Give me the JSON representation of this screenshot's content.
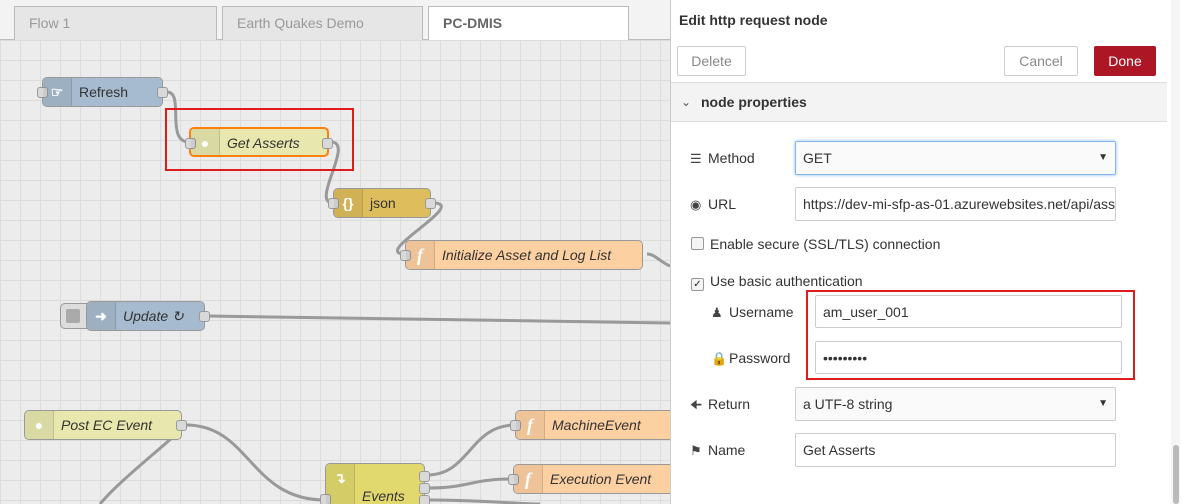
{
  "tabs": [
    {
      "label": "Flow 1"
    },
    {
      "label": "Earth Quakes Demo"
    },
    {
      "label": "PC-DMIS"
    }
  ],
  "nodes": {
    "refresh": {
      "label": "Refresh",
      "icon": "inject-hand-icon",
      "color": "#a6bbcf"
    },
    "get_asserts": {
      "label": "Get Asserts",
      "icon": "globe-icon",
      "color": "#e7e7ae"
    },
    "json": {
      "label": "json",
      "icon": "braces-icon",
      "icon_glyph": "{}",
      "color": "#debd5c"
    },
    "init": {
      "label": "Initialize Asset and Log List",
      "icon": "function-icon",
      "icon_glyph": "f",
      "color": "#fdd0a2"
    },
    "update": {
      "label": "Update ↻",
      "icon": "arrow-right-icon",
      "color": "#a6bbcf"
    },
    "post_ec": {
      "label": "Post EC Event",
      "icon": "globe-icon",
      "color": "#e7e7ae"
    },
    "machine_event": {
      "label": "MachineEvent",
      "icon": "function-icon",
      "icon_glyph": "f",
      "color": "#fdd0a2"
    },
    "execution_event": {
      "label": "Execution Event",
      "icon": "function-icon",
      "icon_glyph": "f",
      "color": "#fdd0a2"
    },
    "events": {
      "label": "Events",
      "icon": "switch-icon",
      "color": "#e2d96e"
    }
  },
  "panel": {
    "title": "Edit http request node",
    "delete_label": "Delete",
    "cancel_label": "Cancel",
    "done_label": "Done",
    "section_title": "node properties",
    "method_label": "Method",
    "method_value": "GET",
    "url_label": "URL",
    "url_value": "https://dev-mi-sfp-as-01.azurewebsites.net/api/ass",
    "tls_label": "Enable secure (SSL/TLS) connection",
    "tls_checked": false,
    "basic_auth_label": "Use basic authentication",
    "basic_auth_checked": true,
    "username_label": "Username",
    "username_value": "am_user_001",
    "password_label": "Password",
    "password_value": "•••••••••",
    "return_label": "Return",
    "return_value": "a UTF-8 string",
    "name_label": "Name",
    "name_value": "Get Asserts"
  },
  "colors": {
    "done": "#ad1625",
    "highlight": "#e01b1b"
  }
}
